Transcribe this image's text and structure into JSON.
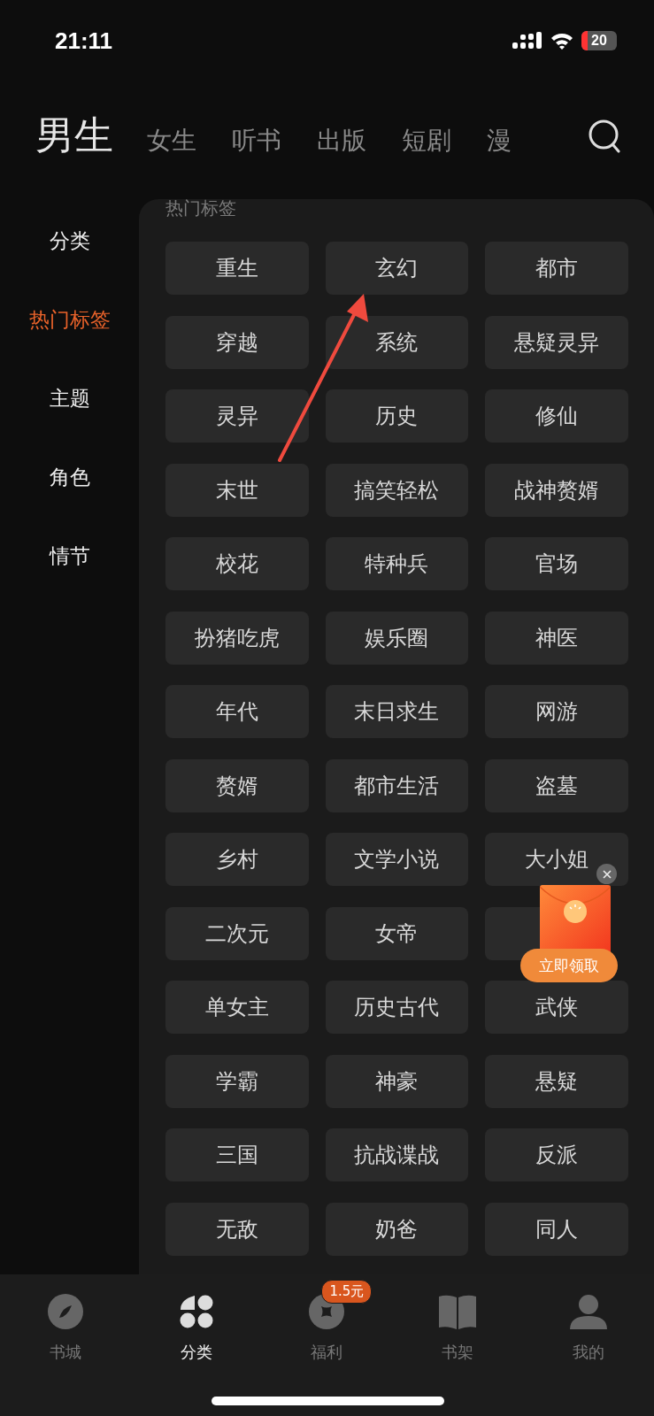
{
  "status_bar": {
    "time": "21:11",
    "battery": "20"
  },
  "top_tabs": [
    {
      "label": "男生",
      "selected": true
    },
    {
      "label": "女生",
      "selected": false
    },
    {
      "label": "听书",
      "selected": false
    },
    {
      "label": "出版",
      "selected": false
    },
    {
      "label": "短剧",
      "selected": false
    },
    {
      "label": "漫",
      "selected": false
    }
  ],
  "sidebar": {
    "items": [
      {
        "label": "分类",
        "selected": false
      },
      {
        "label": "热门标签",
        "selected": true
      },
      {
        "label": "主题",
        "selected": false
      },
      {
        "label": "角色",
        "selected": false
      },
      {
        "label": "情节",
        "selected": false
      }
    ]
  },
  "section_title": "热门标签",
  "tags": [
    {
      "label": "重生"
    },
    {
      "label": "玄幻"
    },
    {
      "label": "都市"
    },
    {
      "label": "穿越"
    },
    {
      "label": "系统"
    },
    {
      "label": "悬疑灵异"
    },
    {
      "label": "灵异"
    },
    {
      "label": "历史"
    },
    {
      "label": "修仙"
    },
    {
      "label": "末世"
    },
    {
      "label": "搞笑轻松"
    },
    {
      "label": "战神赘婿"
    },
    {
      "label": "校花"
    },
    {
      "label": "特种兵"
    },
    {
      "label": "官场"
    },
    {
      "label": "扮猪吃虎"
    },
    {
      "label": "娱乐圈"
    },
    {
      "label": "神医"
    },
    {
      "label": "年代"
    },
    {
      "label": "末日求生"
    },
    {
      "label": "网游"
    },
    {
      "label": "赘婿"
    },
    {
      "label": "都市生活"
    },
    {
      "label": "盗墓"
    },
    {
      "label": "乡村"
    },
    {
      "label": "文学小说"
    },
    {
      "label": "大小姐"
    },
    {
      "label": "二次元"
    },
    {
      "label": "女帝"
    },
    {
      "kind": "covered"
    },
    {
      "label": "单女主"
    },
    {
      "label": "历史古代"
    },
    {
      "label": "武侠"
    },
    {
      "label": "学霸"
    },
    {
      "label": "神豪"
    },
    {
      "label": "悬疑"
    },
    {
      "label": "三国"
    },
    {
      "label": "抗战谍战"
    },
    {
      "label": "反派"
    },
    {
      "label": "无敌"
    },
    {
      "label": "奶爸"
    },
    {
      "label": "同人"
    }
  ],
  "promo": {
    "button": "立即领取"
  },
  "bottom_nav": [
    {
      "label": "书城",
      "selected": false
    },
    {
      "label": "分类",
      "selected": true
    },
    {
      "label": "福利",
      "selected": false,
      "badge": "1.5元"
    },
    {
      "label": "书架",
      "selected": false
    },
    {
      "label": "我的",
      "selected": false
    }
  ]
}
